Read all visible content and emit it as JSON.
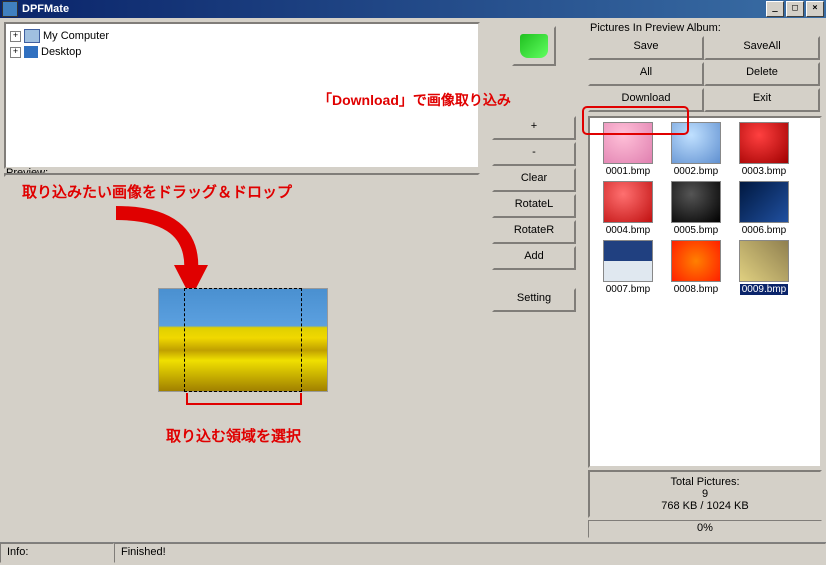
{
  "window": {
    "title": "DPFMate"
  },
  "tree": {
    "items": [
      {
        "label": "My Computer",
        "expandable": true
      },
      {
        "label": "Desktop",
        "expandable": true
      }
    ]
  },
  "preview": {
    "label": "Preview:"
  },
  "annotations": {
    "drag_drop": "取り込みたい画像をドラッグ＆ドロップ",
    "select_region": "取り込む領域を選択",
    "download_note": "「Download」で画像取り込み"
  },
  "mid_buttons": {
    "plus": "+",
    "minus": "-",
    "clear": "Clear",
    "rotatel": "RotateL",
    "rotater": "RotateR",
    "add": "Add",
    "setting": "Setting"
  },
  "right": {
    "header": "Pictures In Preview Album:",
    "buttons": {
      "save": "Save",
      "saveall": "SaveAll",
      "all": "All",
      "delete": "Delete",
      "download": "Download",
      "exit": "Exit"
    },
    "thumbs": [
      {
        "label": "0001.bmp"
      },
      {
        "label": "0002.bmp"
      },
      {
        "label": "0003.bmp"
      },
      {
        "label": "0004.bmp"
      },
      {
        "label": "0005.bmp"
      },
      {
        "label": "0006.bmp"
      },
      {
        "label": "0007.bmp"
      },
      {
        "label": "0008.bmp"
      },
      {
        "label": "0009.bmp"
      }
    ],
    "selected_index": 8,
    "stats": {
      "title": "Total Pictures:",
      "count": "9",
      "size": "768 KB / 1024 KB"
    },
    "progress": "0%"
  },
  "status": {
    "info_label": "Info:",
    "message": "Finished!"
  }
}
